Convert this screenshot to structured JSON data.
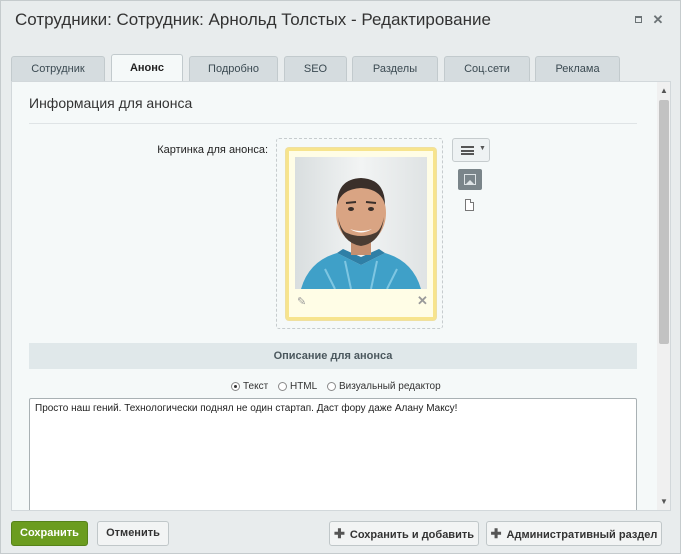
{
  "window": {
    "title": "Сотрудники: Сотрудник: Арнольд Толстых - Редактирование",
    "maximize_icon": "maximize-icon",
    "close_icon": "close-icon"
  },
  "tabs": [
    {
      "label": "Сотрудник",
      "active": false
    },
    {
      "label": "Анонс",
      "active": true
    },
    {
      "label": "Подробно",
      "active": false
    },
    {
      "label": "SEO",
      "active": false
    },
    {
      "label": "Разделы",
      "active": false
    },
    {
      "label": "Соц.сети",
      "active": false
    },
    {
      "label": "Реклама",
      "active": false
    }
  ],
  "section": {
    "title": "Информация для анонса",
    "picture_label": "Картинка для анонса:",
    "picture_alt": "Фото сотрудника",
    "picture_edit_icon": "pencil-icon",
    "picture_delete_icon": "close-icon",
    "menu_icon": "hamburger-menu-icon",
    "image_mode_icon": "image-icon",
    "file_mode_icon": "file-icon"
  },
  "description": {
    "header": "Описание для анонса",
    "modes": [
      {
        "label": "Текст",
        "checked": true
      },
      {
        "label": "HTML",
        "checked": false
      },
      {
        "label": "Визуальный редактор",
        "checked": false
      }
    ],
    "text": "Просто наш гений. Технологически поднял не один стартап. Даст фору даже Алану Максу!"
  },
  "footer": {
    "save": "Сохранить",
    "cancel": "Отменить",
    "save_and_add": "Сохранить и добавить",
    "admin_section": "Административный раздел"
  },
  "colors": {
    "save_button": "#6b9c1f",
    "picture_border": "#f7e48d",
    "active_tab": "#f5f9f9"
  }
}
